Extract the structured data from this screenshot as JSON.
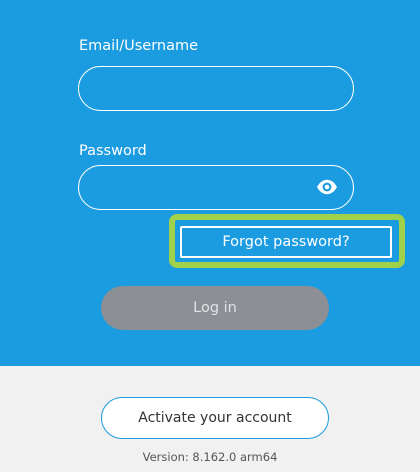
{
  "login_form": {
    "email_label": "Email/Username",
    "email_value": "",
    "password_label": "Password",
    "password_value": "",
    "show_password_icon": "eye-icon",
    "forgot_password_label": "Forgot password?",
    "login_label": "Log in"
  },
  "footer": {
    "activate_label": "Activate your account",
    "version_text": "Version: 8.162.0 arm64"
  },
  "colors": {
    "panel_blue": "#1b9be0",
    "highlight_green": "#9fd14b",
    "login_disabled_gray": "#8c8f94",
    "footer_background": "#f1f1f1"
  }
}
